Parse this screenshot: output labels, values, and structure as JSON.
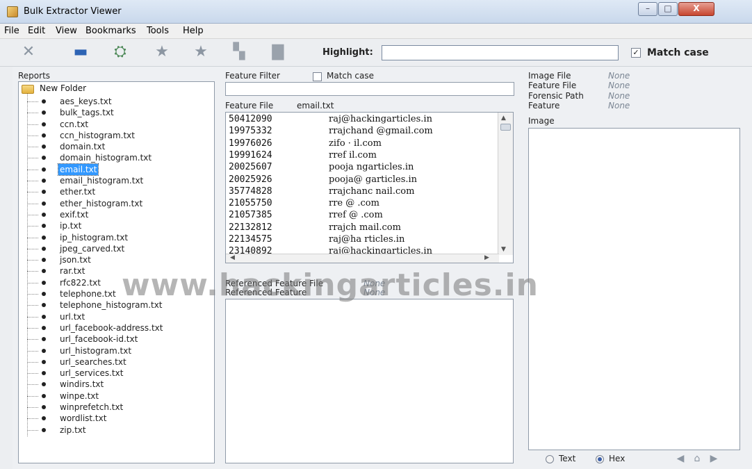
{
  "window": {
    "title": "Bulk Extractor Viewer",
    "controls": {
      "minimize": "–",
      "maximize": "□",
      "close": "X"
    }
  },
  "menu": [
    {
      "label": "File"
    },
    {
      "label": "Edit"
    },
    {
      "label": "View"
    },
    {
      "label": "Bookmarks"
    },
    {
      "label": "Tools"
    },
    {
      "label": "Help"
    }
  ],
  "toolbar": {
    "icons": [
      "close-report-icon",
      "save-icon",
      "open-icon",
      "bookmark-star-icon",
      "bookmark-star-icon",
      "copy-icon",
      "print-icon"
    ],
    "highlight_label": "Highlight:",
    "highlight_value": "",
    "match_case_label": "Match case",
    "match_case_checked": "✓"
  },
  "reports": {
    "label": "Reports",
    "root": "New Folder",
    "items": [
      "aes_keys.txt",
      "bulk_tags.txt",
      "ccn.txt",
      "ccn_histogram.txt",
      "domain.txt",
      "domain_histogram.txt",
      "email.txt",
      "email_histogram.txt",
      "ether.txt",
      "ether_histogram.txt",
      "exif.txt",
      "ip.txt",
      "ip_histogram.txt",
      "jpeg_carved.txt",
      "json.txt",
      "rar.txt",
      "rfc822.txt",
      "telephone.txt",
      "telephone_histogram.txt",
      "url.txt",
      "url_facebook-address.txt",
      "url_facebook-id.txt",
      "url_histogram.txt",
      "url_searches.txt",
      "url_services.txt",
      "windirs.txt",
      "winpe.txt",
      "winprefetch.txt",
      "wordlist.txt",
      "zip.txt"
    ],
    "selected": "email.txt"
  },
  "feature_filter": {
    "label": "Feature Filter",
    "match_case_label": "Match case",
    "value": ""
  },
  "feature_file": {
    "label": "Feature File",
    "value": "email.txt",
    "rows": [
      {
        "offset": "50412090",
        "feature": "raj@hackingarticles.in"
      },
      {
        "offset": "19975332",
        "feature": "rrajchand  @gmail.com"
      },
      {
        "offset": "19976026",
        "feature": "zifo  ·  il.com"
      },
      {
        "offset": "19991624",
        "feature": "rref  il.com"
      },
      {
        "offset": "20025607",
        "feature": "pooja  ngarticles.in"
      },
      {
        "offset": "20025926",
        "feature": "pooja@  garticles.in"
      },
      {
        "offset": "35774828",
        "feature": "rrajchanc  nail.com"
      },
      {
        "offset": "21055750",
        "feature": "rre  @  .com"
      },
      {
        "offset": "21057385",
        "feature": "rref  @  .com"
      },
      {
        "offset": "22132812",
        "feature": "rrajch  mail.com"
      },
      {
        "offset": "22134575",
        "feature": "raj@ha  rticles.in"
      },
      {
        "offset": "23140892",
        "feature": "raj@hackingarticles.in"
      }
    ]
  },
  "referenced": {
    "file_label": "Referenced Feature File",
    "file_value": "None",
    "feature_label": "Referenced Feature",
    "feature_value": "None"
  },
  "info": {
    "image_file_label": "Image File",
    "image_file_value": "None",
    "feature_file_label": "Feature File",
    "feature_file_value": "None",
    "forensic_path_label": "Forensic Path",
    "forensic_path_value": "None",
    "feature_label": "Feature",
    "feature_value": "None",
    "image_label": "Image"
  },
  "view_mode": {
    "text_label": "Text",
    "hex_label": "Hex",
    "selected": "Hex"
  },
  "watermark": "www.hackingarticles.in"
}
